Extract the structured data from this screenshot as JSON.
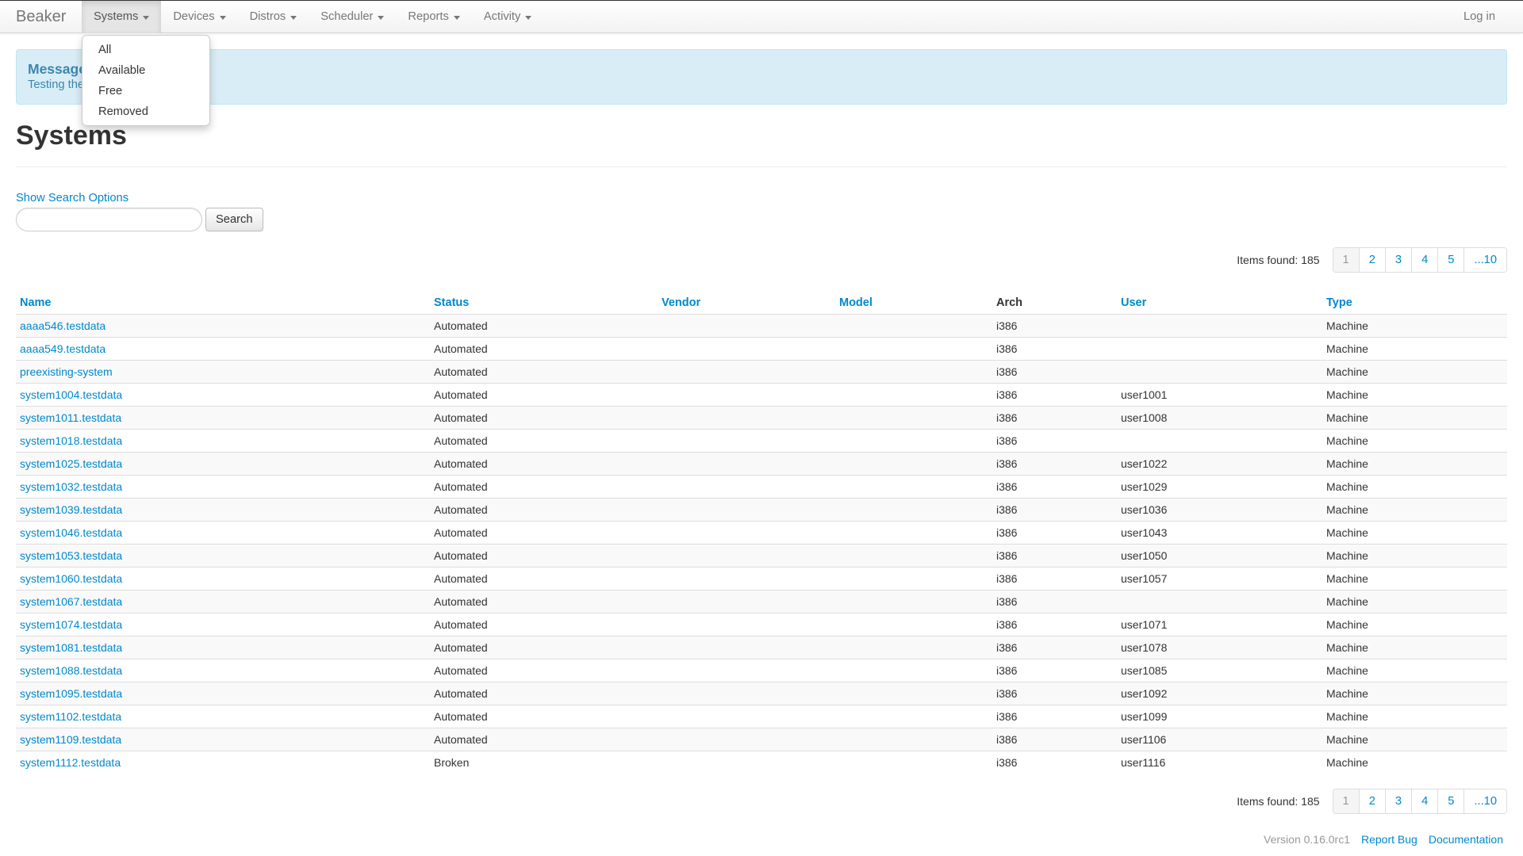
{
  "navbar": {
    "brand": "Beaker",
    "menus": [
      {
        "label": "Systems",
        "icon": "caret-down-icon"
      },
      {
        "label": "Devices",
        "icon": "caret-down-icon"
      },
      {
        "label": "Distros",
        "icon": "caret-down-icon"
      },
      {
        "label": "Scheduler",
        "icon": "caret-down-icon"
      },
      {
        "label": "Reports",
        "icon": "caret-down-icon"
      },
      {
        "label": "Activity",
        "icon": "caret-down-icon"
      }
    ],
    "login": "Log in"
  },
  "dropdown": {
    "items": [
      "All",
      "Available",
      "Free",
      "Removed"
    ]
  },
  "alert": {
    "title": "Message",
    "text": "Testing the"
  },
  "page": {
    "title": "Systems",
    "search_toggle": "Show Search Options",
    "search_placeholder": "",
    "search_button": "Search"
  },
  "pagination": {
    "items_found": "Items found: 185",
    "pages": [
      "1",
      "2",
      "3",
      "4",
      "5",
      "...10"
    ]
  },
  "table": {
    "headers": [
      "Name",
      "Status",
      "Vendor",
      "Model",
      "Arch",
      "User",
      "Type"
    ],
    "rows": [
      [
        "aaaa546.testdata",
        "Automated",
        "",
        "",
        "i386",
        "",
        "Machine"
      ],
      [
        "aaaa549.testdata",
        "Automated",
        "",
        "",
        "i386",
        "",
        "Machine"
      ],
      [
        "preexisting-system",
        "Automated",
        "",
        "",
        "i386",
        "",
        "Machine"
      ],
      [
        "system1004.testdata",
        "Automated",
        "",
        "",
        "i386",
        "user1001",
        "Machine"
      ],
      [
        "system1011.testdata",
        "Automated",
        "",
        "",
        "i386",
        "user1008",
        "Machine"
      ],
      [
        "system1018.testdata",
        "Automated",
        "",
        "",
        "i386",
        "",
        "Machine"
      ],
      [
        "system1025.testdata",
        "Automated",
        "",
        "",
        "i386",
        "user1022",
        "Machine"
      ],
      [
        "system1032.testdata",
        "Automated",
        "",
        "",
        "i386",
        "user1029",
        "Machine"
      ],
      [
        "system1039.testdata",
        "Automated",
        "",
        "",
        "i386",
        "user1036",
        "Machine"
      ],
      [
        "system1046.testdata",
        "Automated",
        "",
        "",
        "i386",
        "user1043",
        "Machine"
      ],
      [
        "system1053.testdata",
        "Automated",
        "",
        "",
        "i386",
        "user1050",
        "Machine"
      ],
      [
        "system1060.testdata",
        "Automated",
        "",
        "",
        "i386",
        "user1057",
        "Machine"
      ],
      [
        "system1067.testdata",
        "Automated",
        "",
        "",
        "i386",
        "",
        "Machine"
      ],
      [
        "system1074.testdata",
        "Automated",
        "",
        "",
        "i386",
        "user1071",
        "Machine"
      ],
      [
        "system1081.testdata",
        "Automated",
        "",
        "",
        "i386",
        "user1078",
        "Machine"
      ],
      [
        "system1088.testdata",
        "Automated",
        "",
        "",
        "i386",
        "user1085",
        "Machine"
      ],
      [
        "system1095.testdata",
        "Automated",
        "",
        "",
        "i386",
        "user1092",
        "Machine"
      ],
      [
        "system1102.testdata",
        "Automated",
        "",
        "",
        "i386",
        "user1099",
        "Machine"
      ],
      [
        "system1109.testdata",
        "Automated",
        "",
        "",
        "i386",
        "user1106",
        "Machine"
      ],
      [
        "system1112.testdata",
        "Broken",
        "",
        "",
        "i386",
        "user1116",
        "Machine"
      ]
    ]
  },
  "footer": {
    "version": "Version 0.16.0rc1",
    "report_bug": "Report Bug",
    "documentation": "Documentation"
  },
  "colors": {
    "link": "#0088cc",
    "alert_bg": "#d9edf7",
    "alert_text": "#3a87ad"
  }
}
